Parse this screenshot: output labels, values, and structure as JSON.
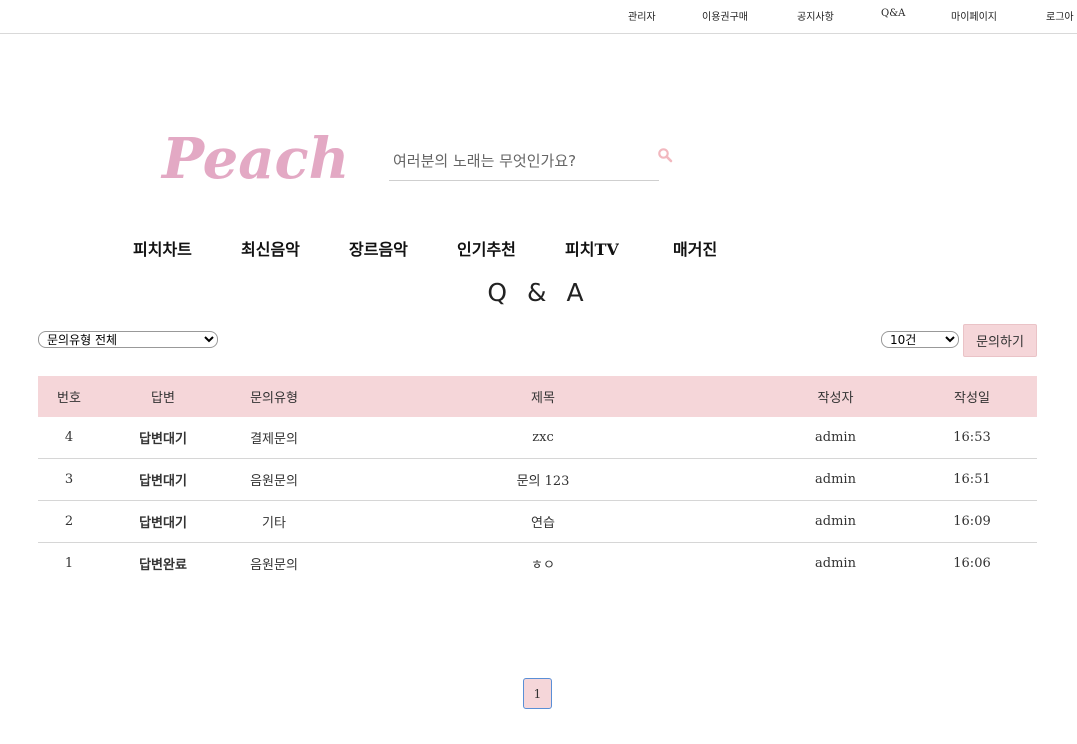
{
  "topnav": {
    "items": [
      "관리자",
      "이용권구매",
      "공지사항",
      "Q&A",
      "마이페이지",
      "로그아"
    ]
  },
  "logo": {
    "text": "Peach",
    "color": "#e3a9c4"
  },
  "search": {
    "placeholder": "여러분의 노래는 무엇인가요?"
  },
  "mainnav": {
    "items": [
      "피치차트",
      "최신음악",
      "장르음악",
      "인기추천",
      "피치TV",
      "매거진"
    ]
  },
  "page": {
    "title": "Q & A"
  },
  "filters": {
    "type_selected": "문의유형 전체",
    "count_selected": "10건",
    "ask_label": "문의하기"
  },
  "table": {
    "headers": [
      "번호",
      "답변",
      "문의유형",
      "제목",
      "작성자",
      "작성일"
    ],
    "rows": [
      {
        "no": "4",
        "status": "답변대기",
        "type": "결제문의",
        "title": "zxc",
        "author": "admin",
        "date": "16:53"
      },
      {
        "no": "3",
        "status": "답변대기",
        "type": "음원문의",
        "title": "문의 123",
        "author": "admin",
        "date": "16:51"
      },
      {
        "no": "2",
        "status": "답변대기",
        "type": "기타",
        "title": "연습",
        "author": "admin",
        "date": "16:09"
      },
      {
        "no": "1",
        "status": "답변완료",
        "type": "음원문의",
        "title": "ㅎㅇ",
        "author": "admin",
        "date": "16:06"
      }
    ]
  },
  "pagination": {
    "current": "1"
  },
  "colors": {
    "accent_pink": "#f5d6d9",
    "status_wait": "#e0141e",
    "status_done": "#1a1adb"
  }
}
